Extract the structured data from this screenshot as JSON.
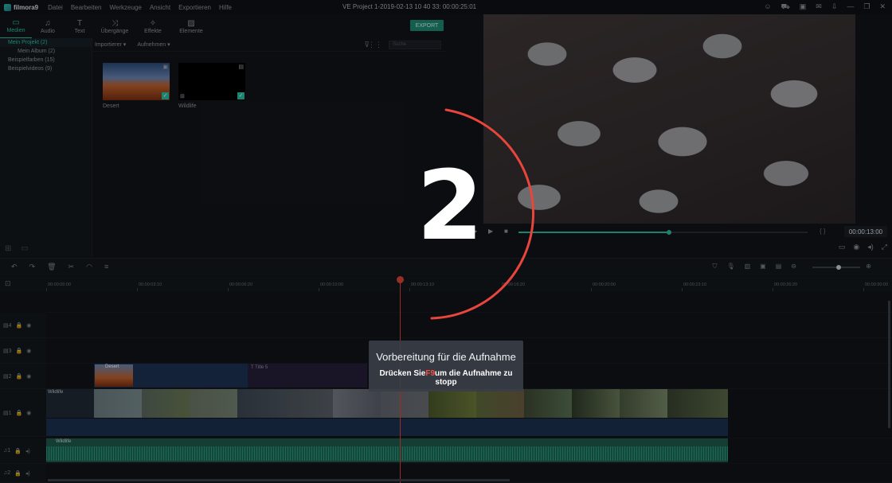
{
  "app": {
    "brand": "filmora9",
    "window_title": "VE Project 1-2019-02-13 10 40 33: 00:00:25:01",
    "menu": [
      "Datei",
      "Bearbeiten",
      "Werkzeuge",
      "Ansicht",
      "Exportieren",
      "Hilfe"
    ]
  },
  "toolbar": {
    "tabs": [
      {
        "label": "Medien",
        "icon": "folder-icon"
      },
      {
        "label": "Audio",
        "icon": "music-icon"
      },
      {
        "label": "Text",
        "icon": "text-icon"
      },
      {
        "label": "Übergänge",
        "icon": "transition-icon"
      },
      {
        "label": "Effekte",
        "icon": "effects-icon"
      },
      {
        "label": "Elemente",
        "icon": "image-icon"
      }
    ],
    "export_label": "EXPORT"
  },
  "library": {
    "items": [
      {
        "label": "Mein Projekt (2)",
        "selected": true
      },
      {
        "label": "Mein Album (2)",
        "sub": true
      },
      {
        "label": "Beispielfarben (15)"
      },
      {
        "label": "Beispielvideos (9)"
      }
    ]
  },
  "media": {
    "import_label": "Importierer",
    "record_label": "Aufnehmen",
    "search_placeholder": "Suche",
    "clips": [
      {
        "name": "Desert"
      },
      {
        "name": "Wildlife"
      }
    ]
  },
  "preview": {
    "timecode": "00:00:13:00",
    "progress": 0.52
  },
  "ruler": {
    "times": [
      "00:00:00:00",
      "00:00:03:10",
      "00:00:06:20",
      "00:00:10:00",
      "00:00:13:10",
      "00:00:16:20",
      "00:00:20:00",
      "00:00:23:10",
      "00:00:26:20",
      "00:00:30:00"
    ]
  },
  "tracks": {
    "video": [
      "4",
      "3",
      "2",
      "1"
    ],
    "audio": [
      "1",
      "2"
    ],
    "title_clip": "Title 5",
    "desert_clip": "Desert",
    "wildlife_clip": "Wildlife",
    "audio_clip": "Wildlife"
  },
  "recording": {
    "countdown": "2",
    "title": "Vorbereitung für die Aufnahme",
    "hint_prefix": "Drücken Sie",
    "hint_key": "F9",
    "hint_suffix": "um die Aufnahme zu stopp"
  },
  "colors": {
    "accent": "#29c3a5",
    "playhead": "#e0443c",
    "countdown_ring": "#e8453c"
  }
}
